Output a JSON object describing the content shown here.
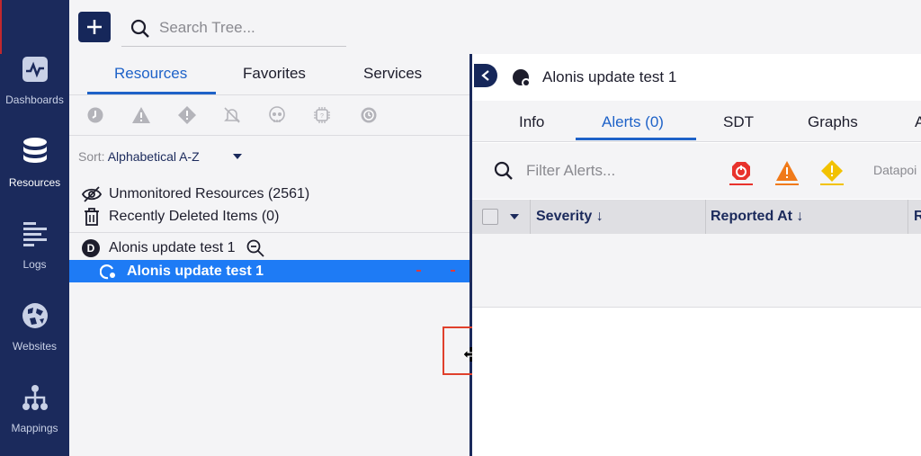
{
  "nav": {
    "items": [
      {
        "label": "Dashboards",
        "icon": "dashboards-icon"
      },
      {
        "label": "Resources",
        "icon": "database-icon",
        "active": true
      },
      {
        "label": "Logs",
        "icon": "logs-icon"
      },
      {
        "label": "Websites",
        "icon": "globe-icon"
      },
      {
        "label": "Mappings",
        "icon": "mappings-icon"
      }
    ]
  },
  "topbar": {
    "add_icon": "plus-icon",
    "search_placeholder": "Search Tree..."
  },
  "left": {
    "tabs": [
      "Resources",
      "Favorites",
      "Services"
    ],
    "active_tab": "Resources",
    "filter_icons": [
      "sdt-clock-icon",
      "warning-triangle-icon",
      "warning-diamond-icon",
      "bell-off-icon",
      "skull-icon",
      "chip-icon",
      "history-icon"
    ],
    "sort_label": "Sort:",
    "sort_value": "Alphabetical A-Z",
    "unmonitored": "Unmonitored Resources (2561)",
    "deleted": "Recently Deleted Items (0)",
    "group_badge": "D",
    "group_name": "Alonis update test 1",
    "selected_resource": "Alonis update test 1"
  },
  "right": {
    "title": "Alonis update test 1",
    "tabs": [
      "Info",
      "Alerts (0)",
      "SDT",
      "Graphs",
      "A"
    ],
    "active_tab": "Alerts (0)",
    "filter_placeholder": "Filter Alerts...",
    "datapoint_label": "Datapoi",
    "severity_colors": {
      "critical": "#e8322c",
      "error": "#f07a1a",
      "warning": "#f2c200"
    },
    "columns": [
      "Severity",
      "Reported At",
      "R"
    ]
  },
  "colors": {
    "nav_bg": "#1b2a5c",
    "accent": "#1e62c8",
    "selected_row": "#1e7bf5"
  }
}
